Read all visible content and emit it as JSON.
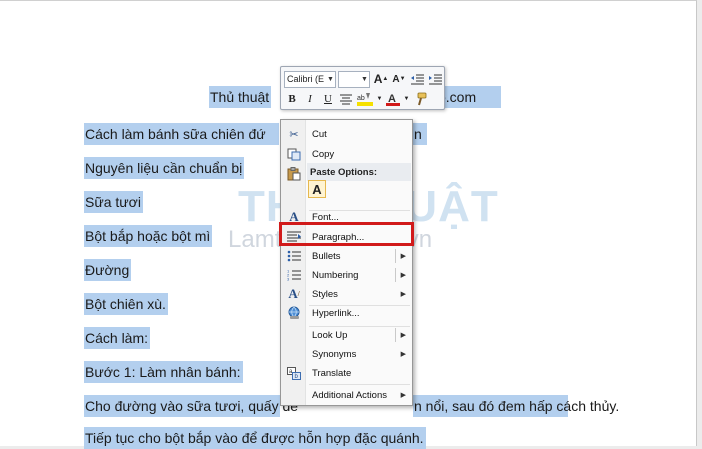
{
  "document": {
    "lines": [
      {
        "pre": "Thủ thuật",
        "post": "o.com"
      },
      {
        "pre": "Cách làm bánh sữa chiên đứ",
        "post": "n"
      },
      {
        "text": "Nguyên liệu cần chuẩn bị"
      },
      {
        "text": "Sữa tươi"
      },
      {
        "text": "Bột bắp hoặc bột mì"
      },
      {
        "text": "Đường"
      },
      {
        "text": "Bột chiên xù."
      },
      {
        "text": "Cách làm:"
      },
      {
        "text": "Bước 1: Làm nhân bánh:"
      },
      {
        "pre": "Cho đường vào sữa tươi, quấy đề",
        "post": "n nổi, sau đó đem hấp cách thủy."
      },
      {
        "text": "Tiếp tục cho bột bắp vào để được hỗn hợp đặc quánh."
      }
    ]
  },
  "watermark": {
    "logo_text": "THỦ THUẬT",
    "sub_text": "Lamthenao.com.vn"
  },
  "mini_toolbar": {
    "font_name": "Calibri (E",
    "font_size": "",
    "buttons_row1": [
      "A",
      "A"
    ],
    "buttons_row2": [
      "B",
      "I",
      "U"
    ]
  },
  "context_menu": {
    "items": {
      "cut": "Cut",
      "copy": "Copy",
      "paste_options": "Paste Options:",
      "paste_keep": "A",
      "font": "Font...",
      "paragraph": "Paragraph...",
      "bullets": "Bullets",
      "numbering": "Numbering",
      "styles": "Styles",
      "hyperlink": "Hyperlink...",
      "look_up": "Look Up",
      "synonyms": "Synonyms",
      "translate": "Translate",
      "additional_actions": "Additional Actions"
    }
  },
  "colors": {
    "selection": "#b3cfee",
    "highlight_box": "#d11a1a",
    "menu_bg": "#fafafa",
    "font_color_bar": "#d11a1a",
    "highlight_bar": "#f5e000"
  }
}
